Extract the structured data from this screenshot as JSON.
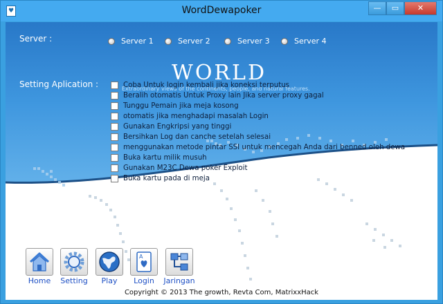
{
  "window": {
    "title": "WordDewapoker",
    "controls": {
      "minimize": "—",
      "maximize": "▭",
      "close": "✕"
    }
  },
  "banner": {
    "heading": "WORLD",
    "subtitle": "Extraordinary views of the continents, people, and natural features."
  },
  "server": {
    "label": "Server   :",
    "options": [
      "Server 1",
      "Server 2",
      "Server 3",
      "Server 4"
    ]
  },
  "settings": {
    "label": "Setting Aplication   :",
    "options": [
      "Coba Untuk login kembali jika koneksi terputus",
      "Beralih otomatis Untuk Proxy lain Jika server proxy gagal",
      "Tunggu Pemain jika meja kosong",
      "otomatis jika menghadapi masalah Login",
      "Gunakan Engkripsi yang tinggi",
      "Bersihkan Log dan canche setelah selesai",
      "menggunakan metode pintar SSI untuk mencegah Anda dari benned oleh dewa",
      "Buka kartu milik musuh",
      "Gunakan M23C Dewa poker Exploit",
      "Buka kartu pada di meja"
    ]
  },
  "nav": {
    "home": "Home",
    "setting": "Setting",
    "play": "Play",
    "login": "Login",
    "jaringan": "Jaringan"
  },
  "footer": "Copyright © 2013 The growth, Revta Com, MatrixxHack",
  "colors": {
    "titlebar": "#44aaf0",
    "banner": "#3f97df",
    "link": "#1d4fc4",
    "close": "#c6392c"
  }
}
